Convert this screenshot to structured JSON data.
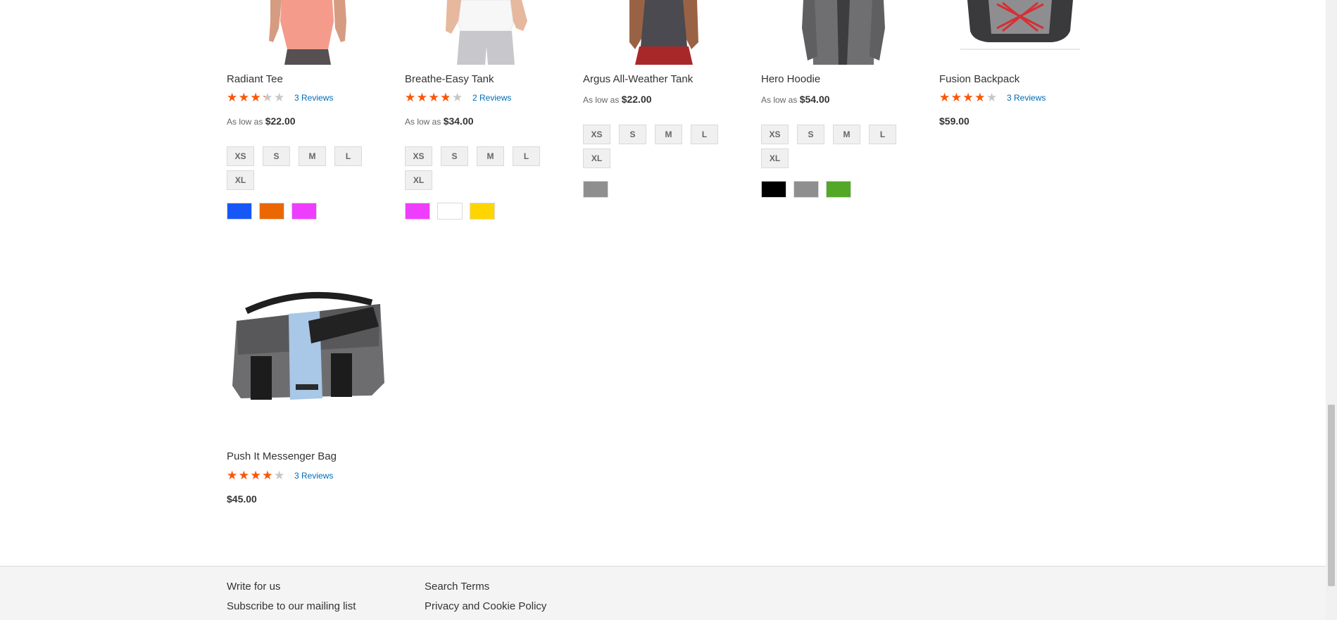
{
  "products": [
    {
      "name": "Radiant Tee",
      "rating_fraction": 0.6,
      "reviews": "3 Reviews",
      "price_prefix": "As low as",
      "price": "$22.00",
      "sizes": [
        "XS",
        "S",
        "M",
        "L",
        "XL"
      ],
      "colors": [
        "#1857f7",
        "#eb6703",
        "#ef3dff"
      ]
    },
    {
      "name": "Breathe-Easy Tank",
      "rating_fraction": 0.7,
      "reviews": "2 Reviews",
      "price_prefix": "As low as",
      "price": "$34.00",
      "sizes": [
        "XS",
        "S",
        "M",
        "L",
        "XL"
      ],
      "colors": [
        "#ef3dff",
        "#ffffff",
        "#ffd500"
      ]
    },
    {
      "name": "Argus All-Weather Tank",
      "price_prefix": "As low as",
      "price": "$22.00",
      "sizes": [
        "XS",
        "S",
        "M",
        "L",
        "XL"
      ],
      "colors": [
        "#8f8f8f"
      ]
    },
    {
      "name": "Hero Hoodie",
      "price_prefix": "As low as",
      "price": "$54.00",
      "sizes": [
        "XS",
        "S",
        "M",
        "L",
        "XL"
      ],
      "colors": [
        "#000000",
        "#8f8f8f",
        "#53a828"
      ]
    },
    {
      "name": "Fusion Backpack",
      "rating_fraction": 0.7,
      "reviews": "3 Reviews",
      "price": "$59.00"
    },
    {
      "name": "Push It Messenger Bag",
      "rating_fraction": 0.7,
      "reviews": "3 Reviews",
      "price": "$45.00"
    }
  ],
  "footer": {
    "links": [
      "Write for us",
      "Subscribe to our mailing list",
      "Search Terms",
      "Privacy and Cookie Policy"
    ]
  }
}
